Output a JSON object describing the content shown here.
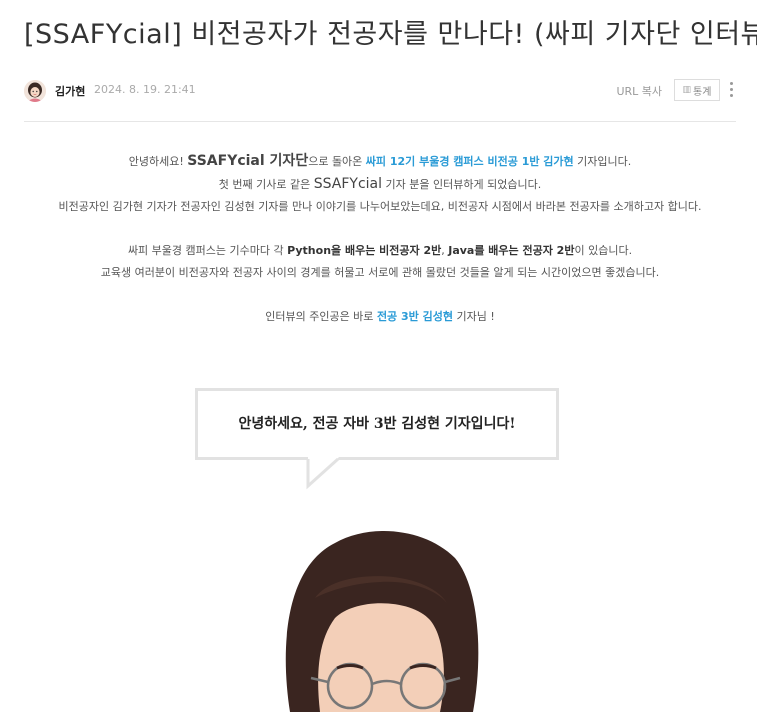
{
  "post": {
    "title": "[SSAFYcial] 비전공자가 전공자를 만나다! (싸피 기자단 인터뷰)",
    "author": "김가현",
    "date": "2024. 8. 19. 21:41",
    "url_copy_label": "URL 복사",
    "stats_label": "통계",
    "stats_icon": "bar-chart-icon",
    "more_icon": "more-vertical-icon"
  },
  "intro": {
    "l1_a": "안녕하세요! ",
    "l1_b": "SSAFYcial 기자단",
    "l1_c": "으로 돌아온 ",
    "l1_d": "싸피 12기 부울경 캠퍼스 비전공 1반 김가현",
    "l1_e": " 기자입니다.",
    "l2_a": "첫 번째 기사로 같은 ",
    "l2_b": "SSAFYcial",
    "l2_c": " 기자 분을 인터뷰하게 되었습니다.",
    "l3": "비전공자인 김가현 기자가 전공자인 김성현 기자를 만나 이야기를 나누어보았는데요, 비전공자 시점에서 바라본 전공자를 소개하고자 합니다.",
    "l4_a": "싸피 부울경 캠퍼스는 기수마다 각 ",
    "l4_b": "Python을 배우는 비전공자 2반",
    "l4_c": ", ",
    "l4_d": "Java를 배우는 전공자 2반",
    "l4_e": "이 있습니다.",
    "l5": "교육생 여러분이 비전공자와 전공자 사이의 경계를 허물고 서로에 관해 몰랐던 것들을 알게 되는 시간이었으면 좋겠습니다.",
    "l6_a": "인터뷰의 주인공은 바로 ",
    "l6_b": "전공 3반 김성현",
    "l6_c": " 기자님 !"
  },
  "bubble": {
    "text": "안녕하세요, 전공 자바 3반 김성현 기자입니다!"
  }
}
